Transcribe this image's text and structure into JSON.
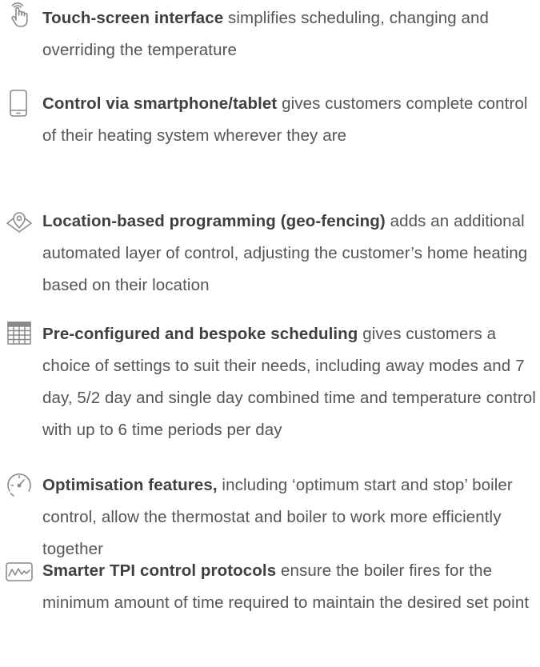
{
  "features": [
    {
      "icon": "touch-hand-icon",
      "title": "Touch-screen interface",
      "description": " simplifies scheduling, changing and overriding the temperature"
    },
    {
      "icon": "smartphone-icon",
      "title": "Control via smartphone/tablet",
      "description": " gives customers complete control of their heating system wherever they are"
    },
    {
      "icon": "location-pin-icon",
      "title": "Location-based programming (geo-fencing)",
      "description": " adds an additional automated layer of control, adjusting the customer’s home heating based on their location"
    },
    {
      "icon": "calendar-icon",
      "title": "Pre-configured and bespoke scheduling",
      "description": " gives customers a choice of settings to suit their needs, including away modes and 7 day, 5/2 day and single day combined time and temperature control with up to 6 time periods per day"
    },
    {
      "icon": "gauge-icon",
      "title": "Optimisation features,",
      "description": " including ‘optimum start and stop’ boiler control, allow the thermostat and boiler to work more efficiently together"
    },
    {
      "icon": "waveform-icon",
      "title": "Smarter TPI control protocols",
      "description": " ensure the boiler fires for the minimum amount of time required to maintain the desired set point"
    }
  ],
  "icon_color": "#8a8a8a",
  "text_color": "#4a4a4a"
}
